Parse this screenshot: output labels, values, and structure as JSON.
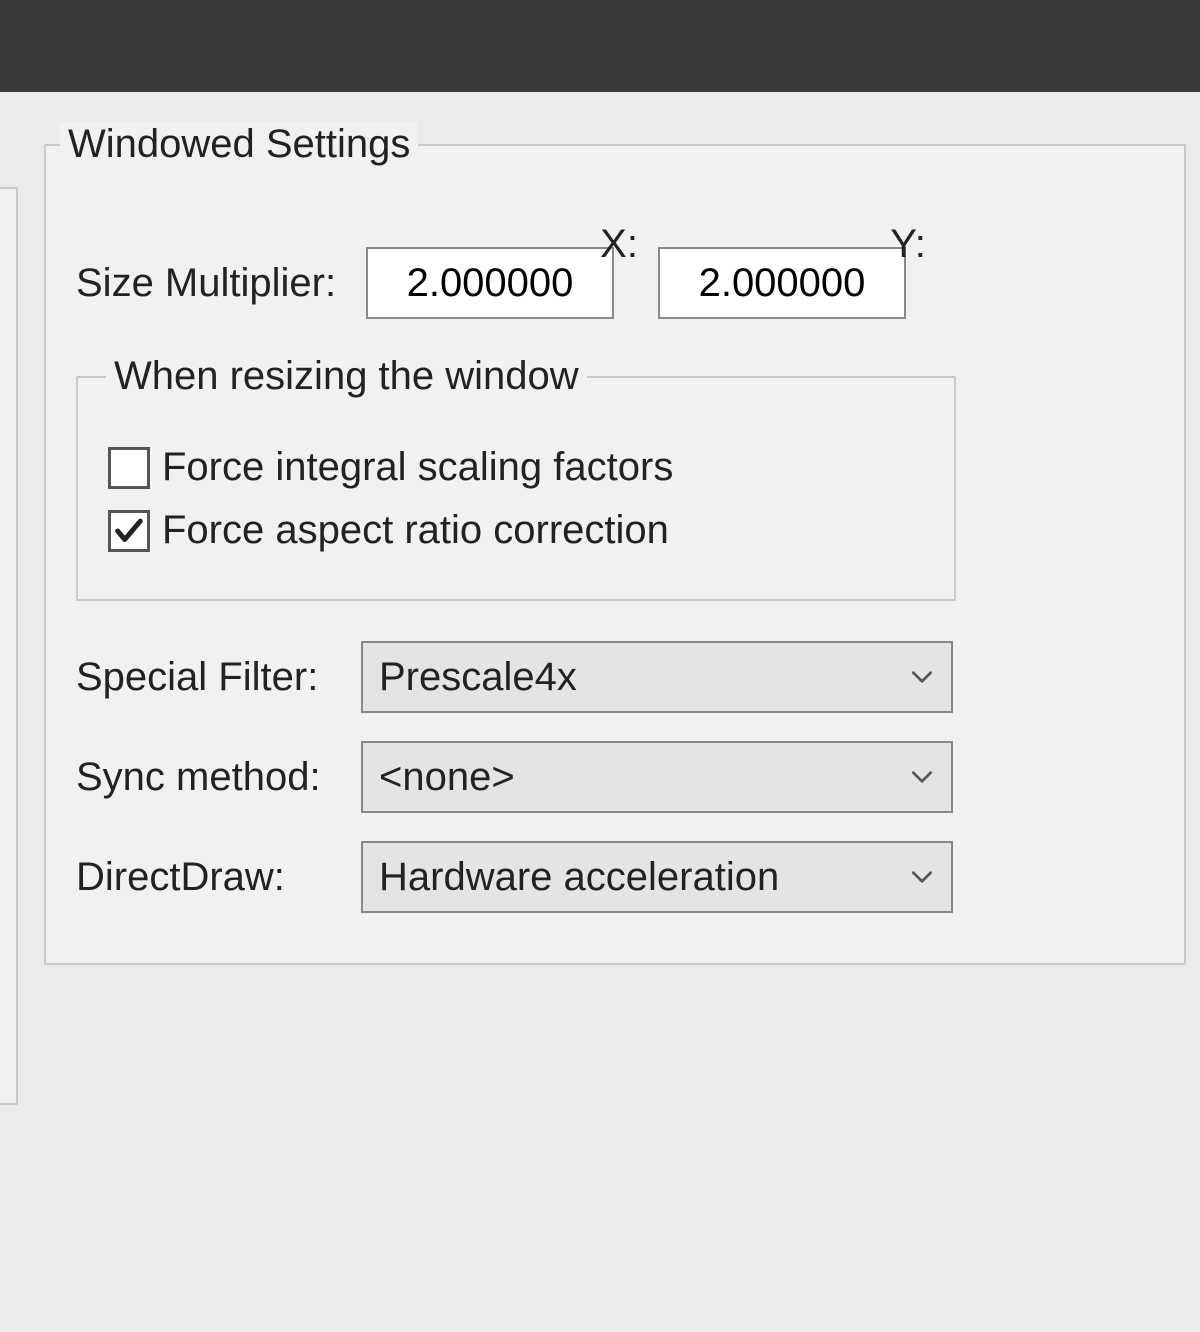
{
  "windowed": {
    "legend": "Windowed Settings",
    "x_header": "X:",
    "y_header": "Y:",
    "size_multiplier_label": "Size Multiplier:",
    "size_multiplier_x": "2.000000",
    "size_multiplier_y": "2.000000",
    "resize": {
      "legend": "When resizing the window",
      "force_integral": {
        "label": "Force integral scaling factors",
        "checked": false
      },
      "force_aspect": {
        "label": "Force aspect ratio correction",
        "checked": true
      }
    },
    "special_filter": {
      "label": "Special Filter:",
      "value": "Prescale4x"
    },
    "sync_method": {
      "label": "Sync method:",
      "value": "<none>"
    },
    "directdraw": {
      "label": "DirectDraw:",
      "value": "Hardware acceleration"
    }
  }
}
